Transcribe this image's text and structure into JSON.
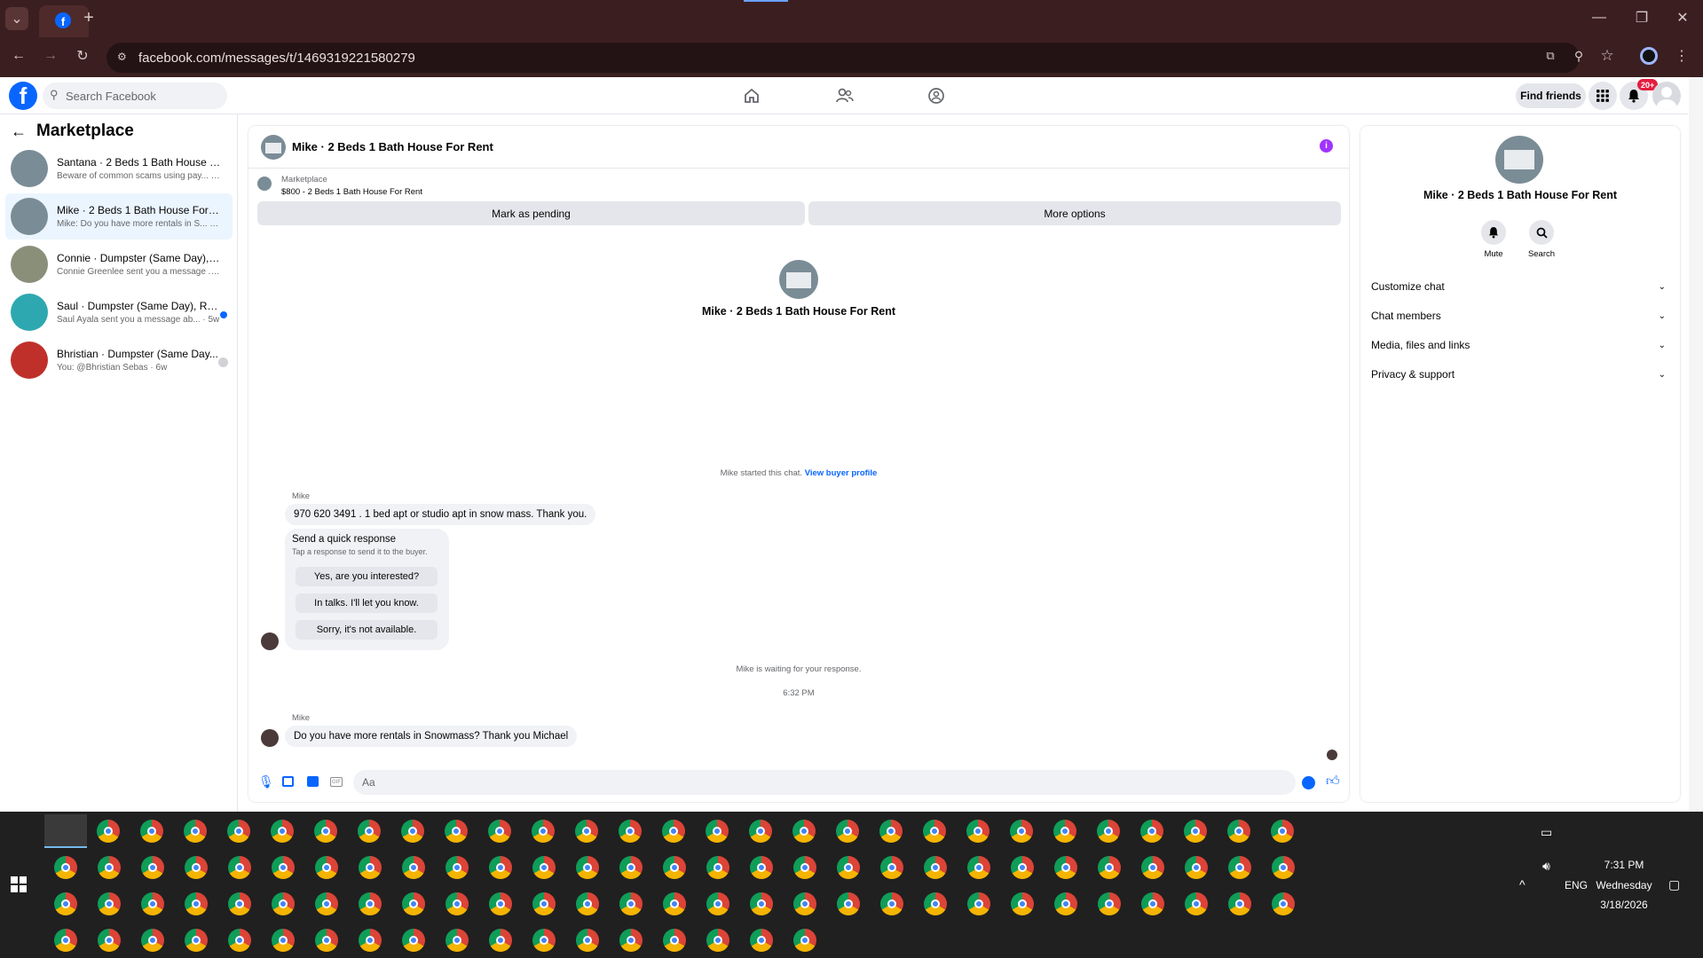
{
  "browser": {
    "url": "facebook.com/messages/t/1469319221580279",
    "new_tab": "+",
    "tab_menu": "⌄"
  },
  "fb": {
    "logo": "f",
    "search_placeholder": "Search Facebook",
    "find_friends": "Find friends",
    "notif_badge": "20+"
  },
  "sidebar": {
    "title": "Marketplace",
    "conversations": [
      {
        "title": "Santana · 2 Beds 1 Bath House For ...",
        "sub": "Beware of common scams using pay... · 1m",
        "thumb": "#7a8c96",
        "selected": false
      },
      {
        "title": "Mike · 2 Beds 1 Bath House For Rent",
        "sub": "Mike: Do you have more rentals in S... · 59m",
        "thumb": "#7a8c96",
        "selected": true
      },
      {
        "title": "Connie · Dumpster (Same Day), Re...",
        "sub": "Connie Greenlee sent you a message ... · 3w",
        "thumb": "#8a8f7a",
        "selected": false
      },
      {
        "title": "Saul · Dumpster (Same Day), Ren...",
        "sub": "Saul Ayala sent you a message ab... · 5w",
        "thumb": "#2ea8b0",
        "selected": false
      },
      {
        "title": "Bhristian · Dumpster (Same Day...",
        "sub": "You: @Bhristian Sebas · 6w",
        "thumb": "#c0302a",
        "selected": false
      }
    ]
  },
  "chat": {
    "header_title": "Mike · 2 Beds 1 Bath House For Rent",
    "listing_label": "Marketplace",
    "listing_price_title": "$800 - 2 Beds 1 Bath House For Rent",
    "mark_pending": "Mark as pending",
    "more_options": "More options",
    "center_title": "Mike · 2 Beds 1 Bath House For Rent",
    "started_text": "Mike started this chat.",
    "view_buyer": "View buyer profile",
    "sender1": "Mike",
    "msg1": "970 620 3491 . 1 bed apt or studio apt in snow mass. Thank you.",
    "qr_title": "Send a quick response",
    "qr_sub": "Tap a response to send it to the buyer.",
    "qr_options": [
      "Yes, are you interested?",
      "In talks. I'll let you know.",
      "Sorry, it's not available."
    ],
    "waiting_text": "Mike is waiting for your response.",
    "timestamp": "6:32 PM",
    "sender2": "Mike",
    "msg2": "Do you have more rentals in Snowmass? Thank you Michael",
    "composer_placeholder": "Aa"
  },
  "rightpane": {
    "title": "Mike · 2 Beds 1 Bath House For Rent",
    "mute": "Mute",
    "search": "Search",
    "rows": [
      "Customize chat",
      "Chat members",
      "Media, files and links",
      "Privacy & support"
    ]
  },
  "tray": {
    "lang": "ENG",
    "time": "7:31 PM",
    "day": "Wednesday",
    "date": "3/18/2026"
  },
  "colors": {
    "fb_blue": "#0866ff",
    "browser_bg": "#3b1f20",
    "taskbar": "#202020",
    "info_purple": "#a033ff"
  }
}
